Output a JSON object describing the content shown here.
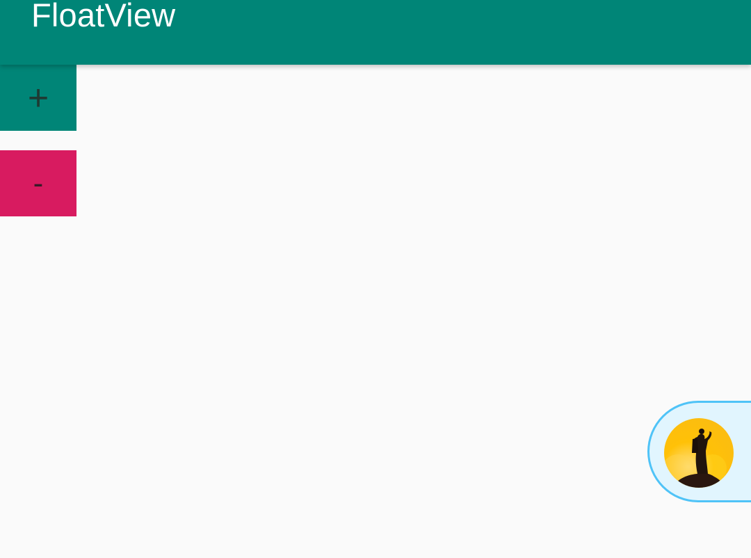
{
  "toolbar": {
    "title": "FloatView",
    "background_color": "#008577"
  },
  "buttons": {
    "plus_label": "+",
    "plus_color": "#008577",
    "minus_label": "-",
    "minus_color": "#d81b60"
  },
  "float_view": {
    "background_color": "#e1f5fe",
    "border_color": "#4fc3f7",
    "avatar": "hiker-silhouette-avatar"
  }
}
